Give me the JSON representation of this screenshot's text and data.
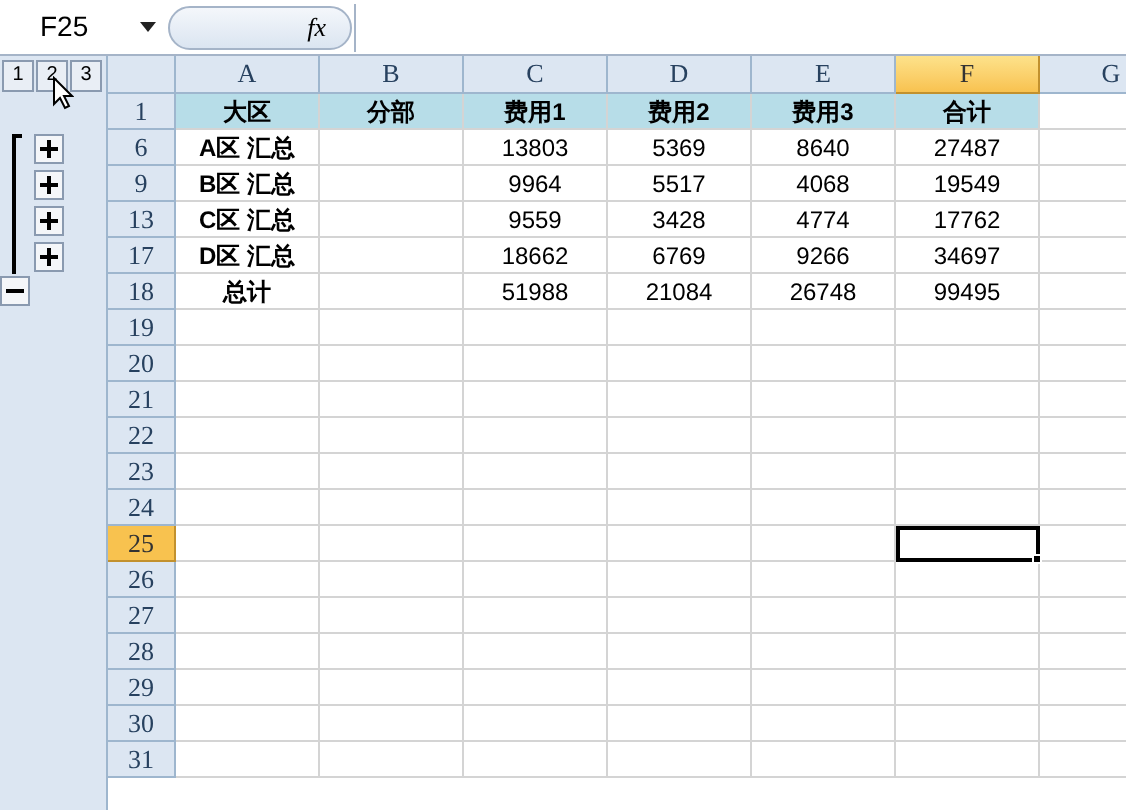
{
  "name_box": {
    "value": "F25"
  },
  "formula_bar": {
    "button": "fx"
  },
  "outline": {
    "levels": [
      "1",
      "2",
      "3"
    ]
  },
  "columns": [
    {
      "label": "A",
      "selected": false
    },
    {
      "label": "B",
      "selected": false
    },
    {
      "label": "C",
      "selected": false
    },
    {
      "label": "D",
      "selected": false
    },
    {
      "label": "E",
      "selected": false
    },
    {
      "label": "F",
      "selected": true
    },
    {
      "label": "G",
      "selected": false
    }
  ],
  "rows": [
    {
      "number": "1",
      "selected": false,
      "kind": "header",
      "cells": [
        "大区",
        "分部",
        "费用1",
        "费用2",
        "费用3",
        "合计"
      ]
    },
    {
      "number": "6",
      "selected": false,
      "kind": "data",
      "outline": {
        "kind": "expand"
      },
      "cells": [
        "A区 汇总",
        "",
        "13803",
        "5369",
        "8640",
        "27487"
      ]
    },
    {
      "number": "9",
      "selected": false,
      "kind": "data",
      "outline": {
        "kind": "expand"
      },
      "cells": [
        "B区 汇总",
        "",
        "9964",
        "5517",
        "4068",
        "19549"
      ]
    },
    {
      "number": "13",
      "selected": false,
      "kind": "data",
      "outline": {
        "kind": "expand"
      },
      "cells": [
        "C区 汇总",
        "",
        "9559",
        "3428",
        "4774",
        "17762"
      ]
    },
    {
      "number": "17",
      "selected": false,
      "kind": "data",
      "outline": {
        "kind": "expand"
      },
      "cells": [
        "D区 汇总",
        "",
        "18662",
        "6769",
        "9266",
        "34697"
      ]
    },
    {
      "number": "18",
      "selected": false,
      "kind": "data",
      "outline": {
        "kind": "collapse"
      },
      "cells": [
        "总计",
        "",
        "51988",
        "21084",
        "26748",
        "99495"
      ]
    },
    {
      "number": "19",
      "selected": false,
      "kind": "empty",
      "cells": []
    },
    {
      "number": "20",
      "selected": false,
      "kind": "empty",
      "cells": []
    },
    {
      "number": "21",
      "selected": false,
      "kind": "empty",
      "cells": []
    },
    {
      "number": "22",
      "selected": false,
      "kind": "empty",
      "cells": []
    },
    {
      "number": "23",
      "selected": false,
      "kind": "empty",
      "cells": []
    },
    {
      "number": "24",
      "selected": false,
      "kind": "empty",
      "cells": []
    },
    {
      "number": "25",
      "selected": true,
      "kind": "empty",
      "cells": []
    },
    {
      "number": "26",
      "selected": false,
      "kind": "empty",
      "cells": []
    },
    {
      "number": "27",
      "selected": false,
      "kind": "empty",
      "cells": []
    },
    {
      "number": "28",
      "selected": false,
      "kind": "empty",
      "cells": []
    },
    {
      "number": "29",
      "selected": false,
      "kind": "empty",
      "cells": []
    },
    {
      "number": "30",
      "selected": false,
      "kind": "empty",
      "cells": []
    },
    {
      "number": "31",
      "selected": false,
      "kind": "empty",
      "cells": []
    }
  ]
}
